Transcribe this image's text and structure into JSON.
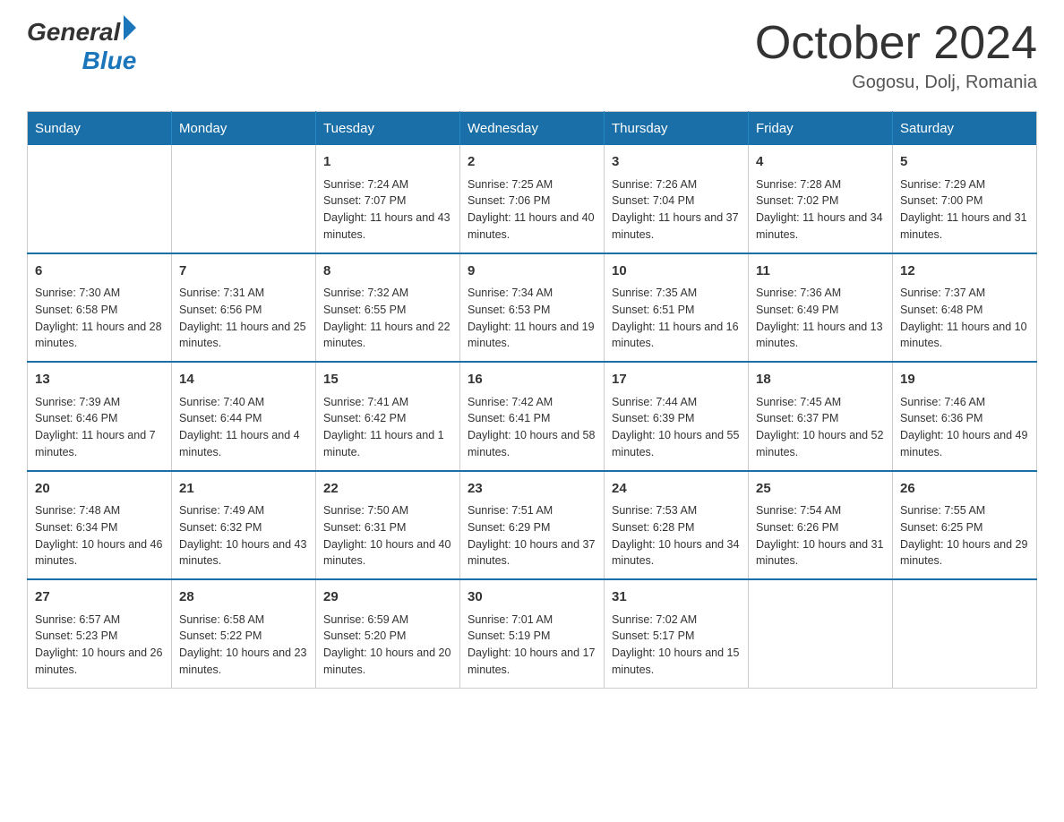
{
  "header": {
    "logo": {
      "general": "General",
      "blue": "Blue",
      "line2": "Blue"
    },
    "title": "October 2024",
    "location": "Gogosu, Dolj, Romania"
  },
  "calendar": {
    "days_of_week": [
      "Sunday",
      "Monday",
      "Tuesday",
      "Wednesday",
      "Thursday",
      "Friday",
      "Saturday"
    ],
    "weeks": [
      [
        {
          "day": "",
          "sunrise": "",
          "sunset": "",
          "daylight": ""
        },
        {
          "day": "",
          "sunrise": "",
          "sunset": "",
          "daylight": ""
        },
        {
          "day": "1",
          "sunrise": "Sunrise: 7:24 AM",
          "sunset": "Sunset: 7:07 PM",
          "daylight": "Daylight: 11 hours and 43 minutes."
        },
        {
          "day": "2",
          "sunrise": "Sunrise: 7:25 AM",
          "sunset": "Sunset: 7:06 PM",
          "daylight": "Daylight: 11 hours and 40 minutes."
        },
        {
          "day": "3",
          "sunrise": "Sunrise: 7:26 AM",
          "sunset": "Sunset: 7:04 PM",
          "daylight": "Daylight: 11 hours and 37 minutes."
        },
        {
          "day": "4",
          "sunrise": "Sunrise: 7:28 AM",
          "sunset": "Sunset: 7:02 PM",
          "daylight": "Daylight: 11 hours and 34 minutes."
        },
        {
          "day": "5",
          "sunrise": "Sunrise: 7:29 AM",
          "sunset": "Sunset: 7:00 PM",
          "daylight": "Daylight: 11 hours and 31 minutes."
        }
      ],
      [
        {
          "day": "6",
          "sunrise": "Sunrise: 7:30 AM",
          "sunset": "Sunset: 6:58 PM",
          "daylight": "Daylight: 11 hours and 28 minutes."
        },
        {
          "day": "7",
          "sunrise": "Sunrise: 7:31 AM",
          "sunset": "Sunset: 6:56 PM",
          "daylight": "Daylight: 11 hours and 25 minutes."
        },
        {
          "day": "8",
          "sunrise": "Sunrise: 7:32 AM",
          "sunset": "Sunset: 6:55 PM",
          "daylight": "Daylight: 11 hours and 22 minutes."
        },
        {
          "day": "9",
          "sunrise": "Sunrise: 7:34 AM",
          "sunset": "Sunset: 6:53 PM",
          "daylight": "Daylight: 11 hours and 19 minutes."
        },
        {
          "day": "10",
          "sunrise": "Sunrise: 7:35 AM",
          "sunset": "Sunset: 6:51 PM",
          "daylight": "Daylight: 11 hours and 16 minutes."
        },
        {
          "day": "11",
          "sunrise": "Sunrise: 7:36 AM",
          "sunset": "Sunset: 6:49 PM",
          "daylight": "Daylight: 11 hours and 13 minutes."
        },
        {
          "day": "12",
          "sunrise": "Sunrise: 7:37 AM",
          "sunset": "Sunset: 6:48 PM",
          "daylight": "Daylight: 11 hours and 10 minutes."
        }
      ],
      [
        {
          "day": "13",
          "sunrise": "Sunrise: 7:39 AM",
          "sunset": "Sunset: 6:46 PM",
          "daylight": "Daylight: 11 hours and 7 minutes."
        },
        {
          "day": "14",
          "sunrise": "Sunrise: 7:40 AM",
          "sunset": "Sunset: 6:44 PM",
          "daylight": "Daylight: 11 hours and 4 minutes."
        },
        {
          "day": "15",
          "sunrise": "Sunrise: 7:41 AM",
          "sunset": "Sunset: 6:42 PM",
          "daylight": "Daylight: 11 hours and 1 minute."
        },
        {
          "day": "16",
          "sunrise": "Sunrise: 7:42 AM",
          "sunset": "Sunset: 6:41 PM",
          "daylight": "Daylight: 10 hours and 58 minutes."
        },
        {
          "day": "17",
          "sunrise": "Sunrise: 7:44 AM",
          "sunset": "Sunset: 6:39 PM",
          "daylight": "Daylight: 10 hours and 55 minutes."
        },
        {
          "day": "18",
          "sunrise": "Sunrise: 7:45 AM",
          "sunset": "Sunset: 6:37 PM",
          "daylight": "Daylight: 10 hours and 52 minutes."
        },
        {
          "day": "19",
          "sunrise": "Sunrise: 7:46 AM",
          "sunset": "Sunset: 6:36 PM",
          "daylight": "Daylight: 10 hours and 49 minutes."
        }
      ],
      [
        {
          "day": "20",
          "sunrise": "Sunrise: 7:48 AM",
          "sunset": "Sunset: 6:34 PM",
          "daylight": "Daylight: 10 hours and 46 minutes."
        },
        {
          "day": "21",
          "sunrise": "Sunrise: 7:49 AM",
          "sunset": "Sunset: 6:32 PM",
          "daylight": "Daylight: 10 hours and 43 minutes."
        },
        {
          "day": "22",
          "sunrise": "Sunrise: 7:50 AM",
          "sunset": "Sunset: 6:31 PM",
          "daylight": "Daylight: 10 hours and 40 minutes."
        },
        {
          "day": "23",
          "sunrise": "Sunrise: 7:51 AM",
          "sunset": "Sunset: 6:29 PM",
          "daylight": "Daylight: 10 hours and 37 minutes."
        },
        {
          "day": "24",
          "sunrise": "Sunrise: 7:53 AM",
          "sunset": "Sunset: 6:28 PM",
          "daylight": "Daylight: 10 hours and 34 minutes."
        },
        {
          "day": "25",
          "sunrise": "Sunrise: 7:54 AM",
          "sunset": "Sunset: 6:26 PM",
          "daylight": "Daylight: 10 hours and 31 minutes."
        },
        {
          "day": "26",
          "sunrise": "Sunrise: 7:55 AM",
          "sunset": "Sunset: 6:25 PM",
          "daylight": "Daylight: 10 hours and 29 minutes."
        }
      ],
      [
        {
          "day": "27",
          "sunrise": "Sunrise: 6:57 AM",
          "sunset": "Sunset: 5:23 PM",
          "daylight": "Daylight: 10 hours and 26 minutes."
        },
        {
          "day": "28",
          "sunrise": "Sunrise: 6:58 AM",
          "sunset": "Sunset: 5:22 PM",
          "daylight": "Daylight: 10 hours and 23 minutes."
        },
        {
          "day": "29",
          "sunrise": "Sunrise: 6:59 AM",
          "sunset": "Sunset: 5:20 PM",
          "daylight": "Daylight: 10 hours and 20 minutes."
        },
        {
          "day": "30",
          "sunrise": "Sunrise: 7:01 AM",
          "sunset": "Sunset: 5:19 PM",
          "daylight": "Daylight: 10 hours and 17 minutes."
        },
        {
          "day": "31",
          "sunrise": "Sunrise: 7:02 AM",
          "sunset": "Sunset: 5:17 PM",
          "daylight": "Daylight: 10 hours and 15 minutes."
        },
        {
          "day": "",
          "sunrise": "",
          "sunset": "",
          "daylight": ""
        },
        {
          "day": "",
          "sunrise": "",
          "sunset": "",
          "daylight": ""
        }
      ]
    ]
  }
}
